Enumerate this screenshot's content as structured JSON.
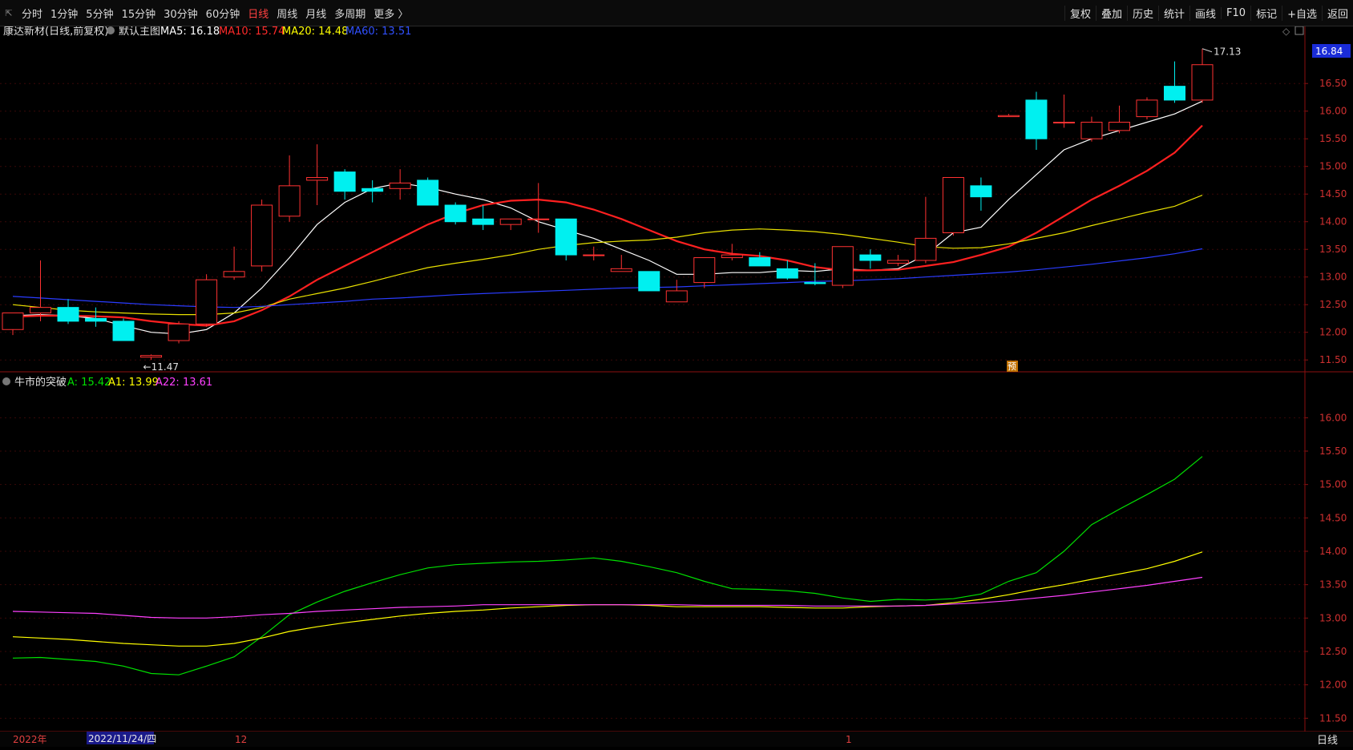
{
  "toolbar": {
    "timeframes": [
      {
        "label": "分时",
        "active": false
      },
      {
        "label": "1分钟",
        "active": false
      },
      {
        "label": "5分钟",
        "active": false
      },
      {
        "label": "15分钟",
        "active": false
      },
      {
        "label": "30分钟",
        "active": false
      },
      {
        "label": "60分钟",
        "active": false
      },
      {
        "label": "日线",
        "active": true
      },
      {
        "label": "周线",
        "active": false
      },
      {
        "label": "月线",
        "active": false
      },
      {
        "label": "多周期",
        "active": false
      },
      {
        "label": "更多",
        "active": false
      }
    ],
    "tools": [
      "复权",
      "叠加",
      "历史",
      "统计",
      "画线",
      "F10",
      "标记",
      "+自选",
      "返回"
    ]
  },
  "main_panel": {
    "stock_title": "康达新材(日线,前复权)",
    "main_chart_label": "默认主图",
    "indicators": [
      {
        "label": "MA5: 16.18",
        "color": "#ffffff"
      },
      {
        "label": "MA10: 15.74",
        "color": "#ff2a2a"
      },
      {
        "label": "MA20: 14.48",
        "color": "#ffff00"
      },
      {
        "label": "MA60: 13.51",
        "color": "#3050ff"
      }
    ],
    "current_price": "16.84",
    "high_label": "17.13",
    "low_label": "11.47",
    "marker_text": "预"
  },
  "sub_panel": {
    "title": "牛市的突破",
    "indicators": [
      {
        "label": "A: 15.42",
        "color": "#00e000"
      },
      {
        "label": "A1: 13.99",
        "color": "#ffff00"
      },
      {
        "label": "A22: 13.61",
        "color": "#ff40ff"
      }
    ]
  },
  "bottom": {
    "year_label": "2022年",
    "selected_date": "2022/11/24/四",
    "month_labels": [
      "12",
      "1"
    ],
    "period_label": "日线"
  },
  "chart_data": [
    {
      "type": "candlestick",
      "title": "康达新材(日线,前复权)",
      "ylim": [
        11.3,
        17.3
      ],
      "y_ticks": [
        11.5,
        12.0,
        12.5,
        13.0,
        13.5,
        14.0,
        14.5,
        15.0,
        15.5,
        16.0,
        16.5
      ],
      "candles": [
        {
          "o": 12.05,
          "h": 12.25,
          "l": 11.95,
          "c": 12.35
        },
        {
          "o": 12.35,
          "h": 13.3,
          "l": 12.2,
          "c": 12.45
        },
        {
          "o": 12.45,
          "h": 12.6,
          "l": 12.15,
          "c": 12.2
        },
        {
          "o": 12.25,
          "h": 12.45,
          "l": 12.1,
          "c": 12.2
        },
        {
          "o": 12.2,
          "h": 12.25,
          "l": 11.85,
          "c": 11.85
        },
        {
          "o": 11.55,
          "h": 11.6,
          "l": 11.5,
          "c": 11.58
        },
        {
          "o": 11.85,
          "h": 12.2,
          "l": 11.8,
          "c": 12.15
        },
        {
          "o": 12.15,
          "h": 13.05,
          "l": 12.1,
          "c": 12.95
        },
        {
          "o": 13.0,
          "h": 13.55,
          "l": 12.95,
          "c": 13.1
        },
        {
          "o": 13.2,
          "h": 14.4,
          "l": 13.1,
          "c": 14.3
        },
        {
          "o": 14.1,
          "h": 15.2,
          "l": 14.0,
          "c": 14.65
        },
        {
          "o": 14.75,
          "h": 15.4,
          "l": 14.3,
          "c": 14.8
        },
        {
          "o": 14.9,
          "h": 14.95,
          "l": 14.4,
          "c": 14.55
        },
        {
          "o": 14.6,
          "h": 14.75,
          "l": 14.35,
          "c": 14.55
        },
        {
          "o": 14.6,
          "h": 14.95,
          "l": 14.4,
          "c": 14.7
        },
        {
          "o": 14.75,
          "h": 14.8,
          "l": 14.3,
          "c": 14.3
        },
        {
          "o": 14.3,
          "h": 14.35,
          "l": 13.95,
          "c": 14.0
        },
        {
          "o": 14.05,
          "h": 14.3,
          "l": 13.85,
          "c": 13.95
        },
        {
          "o": 13.95,
          "h": 14.05,
          "l": 13.85,
          "c": 14.05
        },
        {
          "o": 14.05,
          "h": 14.7,
          "l": 13.8,
          "c": 14.05
        },
        {
          "o": 14.05,
          "h": 14.05,
          "l": 13.3,
          "c": 13.4
        },
        {
          "o": 13.4,
          "h": 13.55,
          "l": 13.3,
          "c": 13.4
        },
        {
          "o": 13.1,
          "h": 13.4,
          "l": 13.1,
          "c": 13.15
        },
        {
          "o": 13.1,
          "h": 13.1,
          "l": 12.75,
          "c": 12.75
        },
        {
          "o": 12.55,
          "h": 12.95,
          "l": 12.55,
          "c": 12.75
        },
        {
          "o": 12.9,
          "h": 13.35,
          "l": 12.8,
          "c": 13.35
        },
        {
          "o": 13.35,
          "h": 13.6,
          "l": 13.3,
          "c": 13.4
        },
        {
          "o": 13.35,
          "h": 13.45,
          "l": 13.2,
          "c": 13.2
        },
        {
          "o": 13.15,
          "h": 13.3,
          "l": 12.95,
          "c": 12.98
        },
        {
          "o": 12.9,
          "h": 13.25,
          "l": 12.85,
          "c": 12.88
        },
        {
          "o": 12.85,
          "h": 13.5,
          "l": 12.8,
          "c": 13.55
        },
        {
          "o": 13.4,
          "h": 13.5,
          "l": 13.15,
          "c": 13.3
        },
        {
          "o": 13.25,
          "h": 13.4,
          "l": 13.2,
          "c": 13.3
        },
        {
          "o": 13.3,
          "h": 14.45,
          "l": 13.25,
          "c": 13.7
        },
        {
          "o": 13.8,
          "h": 14.8,
          "l": 13.75,
          "c": 14.8
        },
        {
          "o": 14.65,
          "h": 14.8,
          "l": 14.2,
          "c": 14.45
        },
        {
          "o": 15.9,
          "h": 15.95,
          "l": 15.9,
          "c": 15.92
        },
        {
          "o": 16.2,
          "h": 16.35,
          "l": 15.3,
          "c": 15.5
        },
        {
          "o": 15.8,
          "h": 16.3,
          "l": 15.7,
          "c": 15.8
        },
        {
          "o": 15.5,
          "h": 15.9,
          "l": 15.45,
          "c": 15.8
        },
        {
          "o": 15.65,
          "h": 16.1,
          "l": 15.6,
          "c": 15.8
        },
        {
          "o": 15.9,
          "h": 16.25,
          "l": 15.85,
          "c": 16.2
        },
        {
          "o": 16.45,
          "h": 16.9,
          "l": 16.15,
          "c": 16.2
        },
        {
          "o": 16.2,
          "h": 17.13,
          "l": 16.15,
          "c": 16.84
        }
      ],
      "series": [
        {
          "name": "MA5",
          "values": [
            12.3,
            12.32,
            12.3,
            12.25,
            12.12,
            12.0,
            11.97,
            12.05,
            12.35,
            12.8,
            13.35,
            13.95,
            14.35,
            14.6,
            14.7,
            14.62,
            14.5,
            14.4,
            14.25,
            14.0,
            13.85,
            13.7,
            13.5,
            13.3,
            13.05,
            13.05,
            13.08,
            13.08,
            13.12,
            13.1,
            13.15,
            13.12,
            13.15,
            13.4,
            13.8,
            13.9,
            14.4,
            14.85,
            15.3,
            15.5,
            15.65,
            15.8,
            15.95,
            16.18
          ]
        },
        {
          "name": "MA10",
          "values": [
            12.28,
            12.3,
            12.3,
            12.29,
            12.27,
            12.2,
            12.15,
            12.12,
            12.2,
            12.4,
            12.65,
            12.95,
            13.2,
            13.45,
            13.7,
            13.95,
            14.15,
            14.3,
            14.38,
            14.4,
            14.35,
            14.22,
            14.05,
            13.85,
            13.65,
            13.5,
            13.42,
            13.38,
            13.3,
            13.18,
            13.12,
            13.12,
            13.13,
            13.2,
            13.27,
            13.4,
            13.55,
            13.8,
            14.1,
            14.4,
            14.65,
            14.92,
            15.25,
            15.74
          ]
        },
        {
          "name": "MA20",
          "values": [
            12.5,
            12.45,
            12.4,
            12.37,
            12.35,
            12.33,
            12.32,
            12.32,
            12.35,
            12.45,
            12.6,
            12.7,
            12.8,
            12.92,
            13.05,
            13.17,
            13.25,
            13.32,
            13.4,
            13.5,
            13.57,
            13.62,
            13.65,
            13.67,
            13.72,
            13.8,
            13.85,
            13.87,
            13.85,
            13.82,
            13.77,
            13.7,
            13.63,
            13.55,
            13.52,
            13.53,
            13.6,
            13.7,
            13.8,
            13.93,
            14.05,
            14.17,
            14.28,
            14.48
          ]
        },
        {
          "name": "MA60",
          "values": [
            12.65,
            12.62,
            12.59,
            12.56,
            12.53,
            12.5,
            12.48,
            12.46,
            12.45,
            12.47,
            12.5,
            12.53,
            12.56,
            12.6,
            12.62,
            12.65,
            12.68,
            12.7,
            12.72,
            12.74,
            12.76,
            12.78,
            12.8,
            12.81,
            12.82,
            12.84,
            12.86,
            12.88,
            12.9,
            12.92,
            12.93,
            12.95,
            12.97,
            13.0,
            13.03,
            13.06,
            13.09,
            13.13,
            13.18,
            13.23,
            13.29,
            13.35,
            13.42,
            13.51
          ]
        }
      ]
    },
    {
      "type": "line",
      "title": "牛市的突破",
      "ylim": [
        11.3,
        16.4
      ],
      "y_ticks": [
        11.5,
        12.0,
        12.5,
        13.0,
        13.5,
        14.0,
        14.5,
        15.0,
        15.5,
        16.0
      ],
      "series": [
        {
          "name": "A",
          "color": "#00e000",
          "values": [
            12.4,
            12.41,
            12.38,
            12.35,
            12.28,
            12.17,
            12.15,
            12.28,
            12.42,
            12.72,
            13.05,
            13.24,
            13.4,
            13.53,
            13.65,
            13.75,
            13.8,
            13.82,
            13.84,
            13.85,
            13.87,
            13.9,
            13.85,
            13.77,
            13.68,
            13.55,
            13.44,
            13.43,
            13.41,
            13.37,
            13.3,
            13.25,
            13.28,
            13.27,
            13.29,
            13.36,
            13.55,
            13.68,
            14.0,
            14.4,
            14.63,
            14.85,
            15.08,
            15.42
          ]
        },
        {
          "name": "A1",
          "color": "#ffff00",
          "values": [
            12.72,
            12.7,
            12.68,
            12.65,
            12.62,
            12.6,
            12.58,
            12.58,
            12.62,
            12.7,
            12.8,
            12.87,
            12.93,
            12.98,
            13.03,
            13.07,
            13.1,
            13.12,
            13.15,
            13.17,
            13.19,
            13.2,
            13.2,
            13.19,
            13.17,
            13.17,
            13.17,
            13.17,
            13.16,
            13.15,
            13.15,
            13.17,
            13.18,
            13.19,
            13.23,
            13.28,
            13.35,
            13.43,
            13.5,
            13.58,
            13.66,
            13.74,
            13.85,
            13.99
          ]
        },
        {
          "name": "A22",
          "color": "#ff40ff",
          "values": [
            13.1,
            13.09,
            13.08,
            13.07,
            13.04,
            13.01,
            13.0,
            13.0,
            13.02,
            13.05,
            13.07,
            13.1,
            13.12,
            13.14,
            13.16,
            13.17,
            13.18,
            13.2,
            13.2,
            13.2,
            13.2,
            13.2,
            13.2,
            13.2,
            13.2,
            13.19,
            13.19,
            13.19,
            13.19,
            13.18,
            13.18,
            13.18,
            13.18,
            13.19,
            13.21,
            13.23,
            13.26,
            13.3,
            13.34,
            13.39,
            13.44,
            13.49,
            13.55,
            13.61
          ]
        }
      ]
    }
  ]
}
